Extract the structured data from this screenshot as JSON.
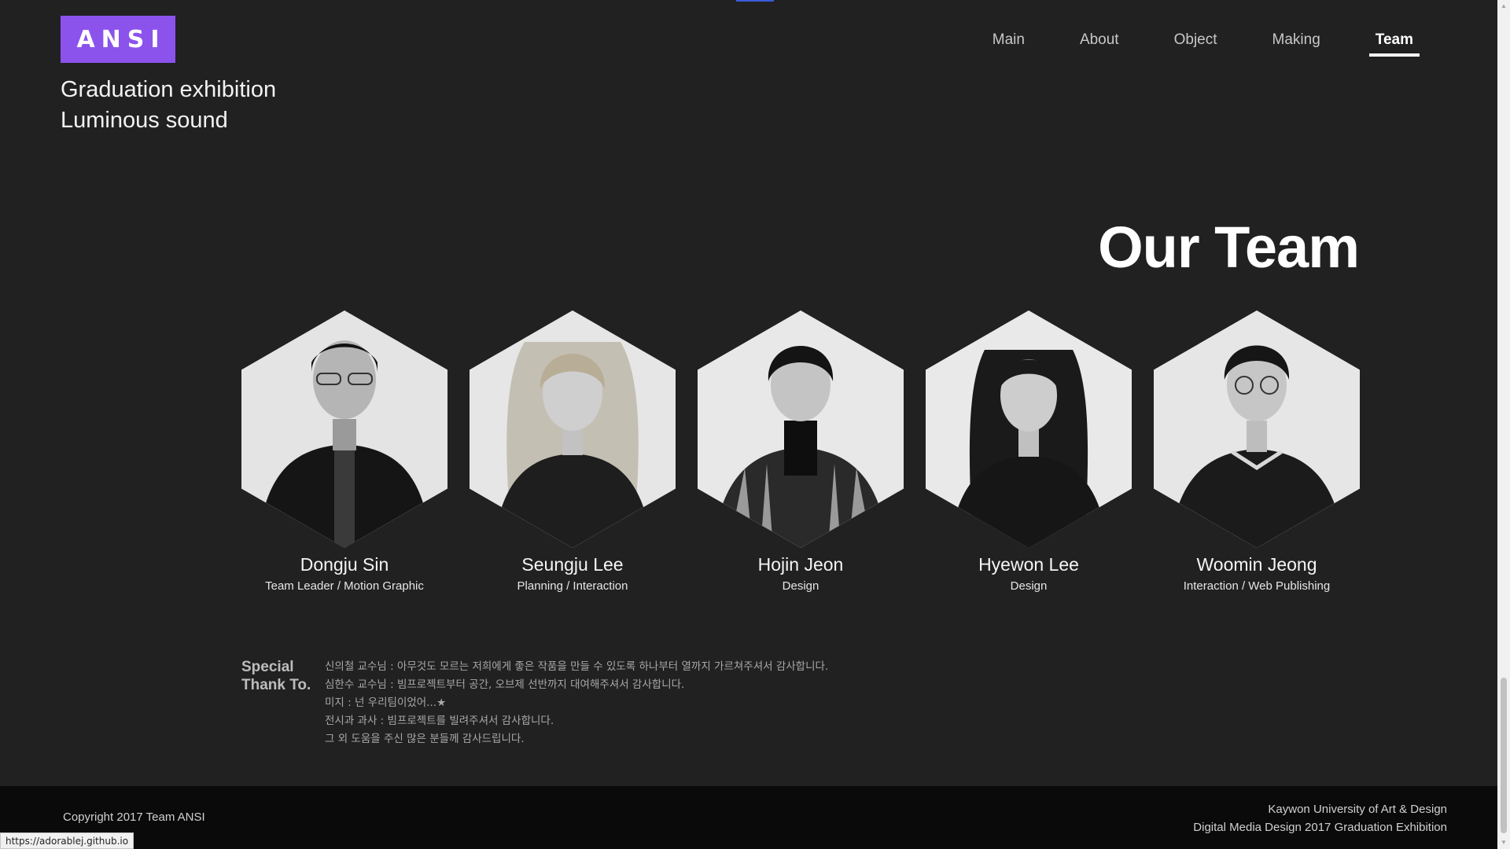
{
  "brand": {
    "logo_text": "ANSI",
    "tagline_line1": "Graduation exhibition",
    "tagline_line2": "Luminous sound",
    "accent_color": "#8c52ec"
  },
  "nav": {
    "items": [
      {
        "label": "Main",
        "active": false
      },
      {
        "label": "About",
        "active": false
      },
      {
        "label": "Object",
        "active": false
      },
      {
        "label": "Making",
        "active": false
      },
      {
        "label": "Team",
        "active": true
      }
    ]
  },
  "team_section": {
    "title": "Our Team",
    "members": [
      {
        "name": "Dongju Sin",
        "role": "Team Leader / Motion Graphic"
      },
      {
        "name": "Seungju Lee",
        "role": "Planning / Interaction"
      },
      {
        "name": "Hojin Jeon",
        "role": "Design"
      },
      {
        "name": "Hyewon Lee",
        "role": "Design"
      },
      {
        "name": "Woomin Jeong",
        "role": "Interaction / Web Publishing"
      }
    ]
  },
  "special_thanks": {
    "title_line1": "Special",
    "title_line2": "Thank To.",
    "lines": [
      "신의철 교수님 : 아무것도 모르는 저희에게 좋은 작품을 만들 수 있도록 하나부터 열까지 가르쳐주셔서 감사합니다.",
      "심한수 교수님 : 빔프로젝트부터 공간, 오브제 선반까지 대여해주셔서 감사합니다.",
      "미지 : 넌 우리팀이었어...★",
      "전시과 과사 : 빔프로젝트를 빌려주셔서 감사합니다.",
      "그 외 도움을 주신 많은 분들께 감사드립니다."
    ]
  },
  "footer": {
    "copyright": "Copyright 2017 Team ANSI",
    "school": "Kaywon University of Art & Design",
    "exhibition": "Digital Media Design 2017 Graduation Exhibition"
  },
  "status_bar": {
    "url": "https://adorablej.github.io"
  }
}
